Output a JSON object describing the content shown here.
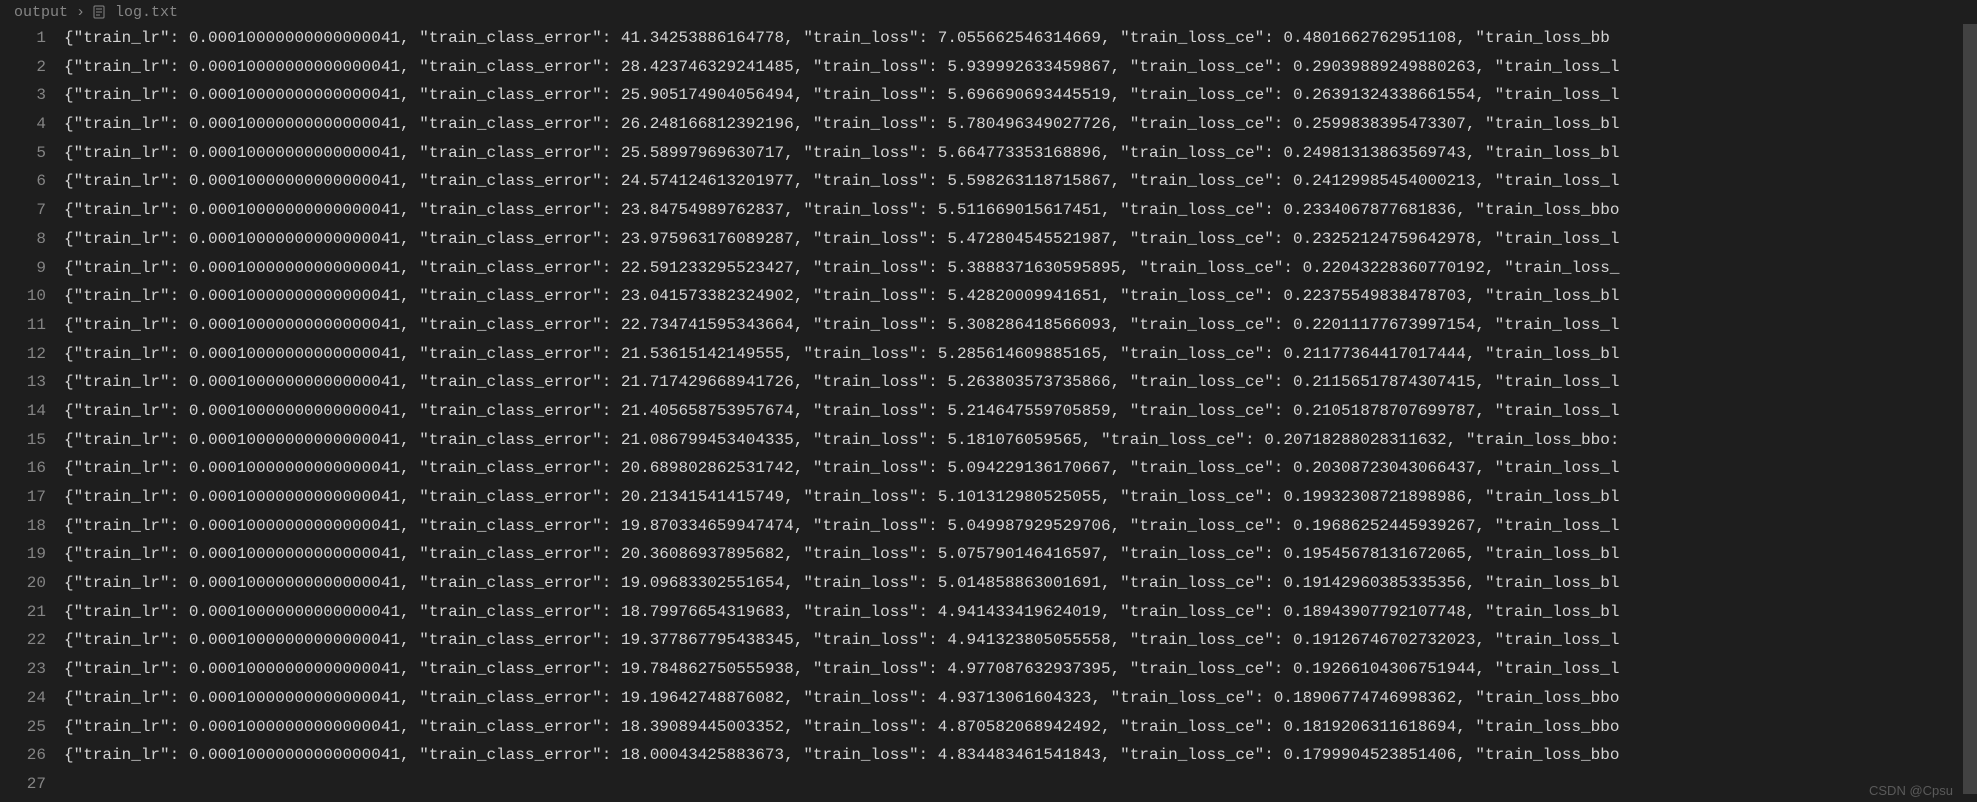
{
  "breadcrumb": {
    "folder": "output",
    "separator": "›",
    "file": "log.txt"
  },
  "watermark": "CSDN @Cpsu",
  "lines": [
    {
      "num": "1",
      "text": "{\"train_lr\": 0.00010000000000000041, \"train_class_error\": 41.34253886164778, \"train_loss\": 7.055662546314669, \"train_loss_ce\": 0.4801662762951108, \"train_loss_bb"
    },
    {
      "num": "2",
      "text": "{\"train_lr\": 0.00010000000000000041, \"train_class_error\": 28.42374632924148​5, \"train_loss\": 5.939992633459867, \"train_loss_ce\": 0.29039889249880263, \"train_loss_l"
    },
    {
      "num": "3",
      "text": "{\"train_lr\": 0.00010000000000000041, \"train_class_error\": 25.905174904056494, \"train_loss\": 5.696690693445519, \"train_loss_ce\": 0.26391324338661554, \"train_loss_l"
    },
    {
      "num": "4",
      "text": "{\"train_lr\": 0.00010000000000000041, \"train_class_error\": 26.248166812392196, \"train_loss\": 5.780496349027726, \"train_loss_ce\": 0.2599838395473307, \"train_loss_bl"
    },
    {
      "num": "5",
      "text": "{\"train_lr\": 0.00010000000000000041, \"train_class_error\": 25.58997969630717, \"train_loss\": 5.664773353168896, \"train_loss_ce\": 0.24981313863569743, \"train_loss_bl"
    },
    {
      "num": "6",
      "text": "{\"train_lr\": 0.00010000000000000041, \"train_class_error\": 24.574124613201977, \"train_loss\": 5.598263118715867, \"train_loss_ce\": 0.24129985454000213, \"train_loss_l"
    },
    {
      "num": "7",
      "text": "{\"train_lr\": 0.00010000000000000041, \"train_class_error\": 23.84754989762837, \"train_loss\": 5.511669015617451, \"train_loss_ce\": 0.2334067877681836, \"train_loss_bbo"
    },
    {
      "num": "8",
      "text": "{\"train_lr\": 0.00010000000000000041, \"train_class_error\": 23.975963176089287, \"train_loss\": 5.472804545521987, \"train_loss_ce\": 0.23252124759642978, \"train_loss_l"
    },
    {
      "num": "9",
      "text": "{\"train_lr\": 0.00010000000000000041, \"train_class_error\": 22.591233295523427, \"train_loss\": 5.3888371630595895, \"train_loss_ce\": 0.22043228360770192, \"train_loss_"
    },
    {
      "num": "10",
      "text": "{\"train_lr\": 0.00010000000000000041, \"train_class_error\": 23.041573382324902, \"train_loss\": 5.42820009941651, \"train_loss_ce\": 0.22375549838478703, \"train_loss_bl"
    },
    {
      "num": "11",
      "text": "{\"train_lr\": 0.00010000000000000041, \"train_class_error\": 22.734741595343664, \"train_loss\": 5.308286418566093, \"train_loss_ce\": 0.22011177673997154, \"train_loss_l"
    },
    {
      "num": "12",
      "text": "{\"train_lr\": 0.00010000000000000041, \"train_class_error\": 21.53615142149555, \"train_loss\": 5.285614609885165, \"train_loss_ce\": 0.21177364417017444, \"train_loss_bl"
    },
    {
      "num": "13",
      "text": "{\"train_lr\": 0.00010000000000000041, \"train_class_error\": 21.717429668941726, \"train_loss\": 5.263803573735866, \"train_loss_ce\": 0.21156517874307415, \"train_loss_l"
    },
    {
      "num": "14",
      "text": "{\"train_lr\": 0.00010000000000000041, \"train_class_error\": 21.405658753957674, \"train_loss\": 5.214647559705859, \"train_loss_ce\": 0.21051878707699787, \"train_loss_l"
    },
    {
      "num": "15",
      "text": "{\"train_lr\": 0.00010000000000000041, \"train_class_error\": 21.086799453404335, \"train_loss\": 5.181076059565, \"train_loss_ce\": 0.20718288028311632, \"train_loss_bbo:"
    },
    {
      "num": "16",
      "text": "{\"train_lr\": 0.00010000000000000041, \"train_class_error\": 20.689802862531742, \"train_loss\": 5.094229136170667, \"train_loss_ce\": 0.20308723043066437, \"train_loss_l"
    },
    {
      "num": "17",
      "text": "{\"train_lr\": 0.00010000000000000041, \"train_class_error\": 20.21341541415749, \"train_loss\": 5.101312980525055, \"train_loss_ce\": 0.19932308721898986, \"train_loss_bl"
    },
    {
      "num": "18",
      "text": "{\"train_lr\": 0.00010000000000000041, \"train_class_error\": 19.870334659947474, \"train_loss\": 5.049987929529706, \"train_loss_ce\": 0.19686252445939267, \"train_loss_l"
    },
    {
      "num": "19",
      "text": "{\"train_lr\": 0.00010000000000000041, \"train_class_error\": 20.36086937895682, \"train_loss\": 5.075790146416597, \"train_loss_ce\": 0.19545678131672065, \"train_loss_bl"
    },
    {
      "num": "20",
      "text": "{\"train_lr\": 0.00010000000000000041, \"train_class_error\": 19.09683302551654, \"train_loss\": 5.014858863001691, \"train_loss_ce\": 0.19142960385335356, \"train_loss_bl"
    },
    {
      "num": "21",
      "text": "{\"train_lr\": 0.00010000000000000041, \"train_class_error\": 18.79976654319683, \"train_loss\": 4.941433419624019, \"train_loss_ce\": 0.18943907792107748, \"train_loss_bl"
    },
    {
      "num": "22",
      "text": "{\"train_lr\": 0.00010000000000000041, \"train_class_error\": 19.377867795438345, \"train_loss\": 4.941323805055558, \"train_loss_ce\": 0.19126746702732023, \"train_loss_l"
    },
    {
      "num": "23",
      "text": "{\"train_lr\": 0.00010000000000000041, \"train_class_error\": 19.784862750555938, \"train_loss\": 4.977087632937395, \"train_loss_ce\": 0.19266104306751944, \"train_loss_l"
    },
    {
      "num": "24",
      "text": "{\"train_lr\": 0.00010000000000000041, \"train_class_error\": 19.19642748876082, \"train_loss\": 4.93713061604323, \"train_loss_ce\": 0.18906774746998362, \"train_loss_bbo"
    },
    {
      "num": "25",
      "text": "{\"train_lr\": 0.00010000000000000041, \"train_class_error\": 18.39089445003352, \"train_loss\": 4.870582068942492, \"train_loss_ce\": 0.1819206311618694, \"train_loss_bbo"
    },
    {
      "num": "26",
      "text": "{\"train_lr\": 0.00010000000000000041, \"train_class_error\": 18.00043425883673, \"train_loss\": 4.834483461541843, \"train_loss_ce\": 0.1799904523851406, \"train_loss_bbo"
    },
    {
      "num": "27",
      "text": ""
    }
  ]
}
